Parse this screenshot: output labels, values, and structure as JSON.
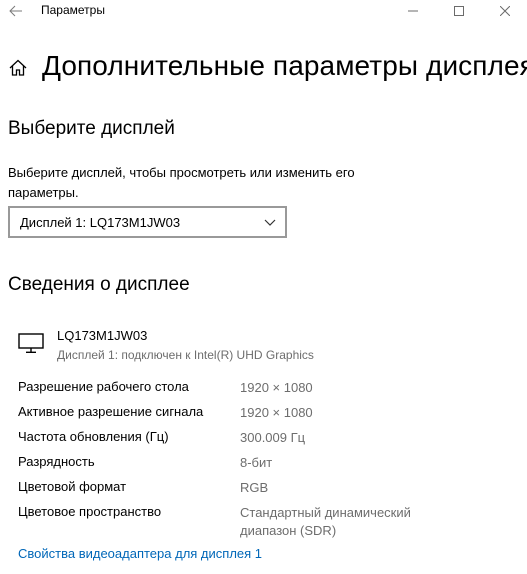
{
  "window": {
    "title": "Параметры",
    "back_icon": "arrow-left-icon",
    "controls": [
      "minimize-icon",
      "maximize-icon",
      "close-icon"
    ]
  },
  "header": {
    "icon": "home-icon",
    "title": "Дополнительные параметры дисплея"
  },
  "select_display": {
    "heading": "Выберите дисплей",
    "description": "Выберите дисплей, чтобы просмотреть или изменить его параметры.",
    "dropdown": {
      "selected": "Дисплей 1: LQ173M1JW03",
      "icon": "chevron-down-icon"
    }
  },
  "display_info": {
    "heading": "Сведения о дисплее",
    "icon": "monitor-icon",
    "name": "LQ173M1JW03",
    "subtitle": "Дисплей 1: подключен к Intel(R) UHD Graphics",
    "properties": [
      {
        "label": "Разрешение рабочего стола",
        "value": "1920 × 1080"
      },
      {
        "label": "Активное разрешение сигнала",
        "value": "1920 × 1080"
      },
      {
        "label": "Частота обновления (Гц)",
        "value": "300.009 Гц"
      },
      {
        "label": "Разрядность",
        "value": "8-бит"
      },
      {
        "label": "Цветовой формат",
        "value": "RGB"
      },
      {
        "label": "Цветовое пространство",
        "value": "Стандартный динамический диапазон (SDR)"
      }
    ],
    "adapter_link": "Свойства видеоадаптера для дисплея 1"
  },
  "colors": {
    "link": "#0067b8",
    "secondary_text": "#6d6d6d",
    "dropdown_border": "#999999"
  }
}
